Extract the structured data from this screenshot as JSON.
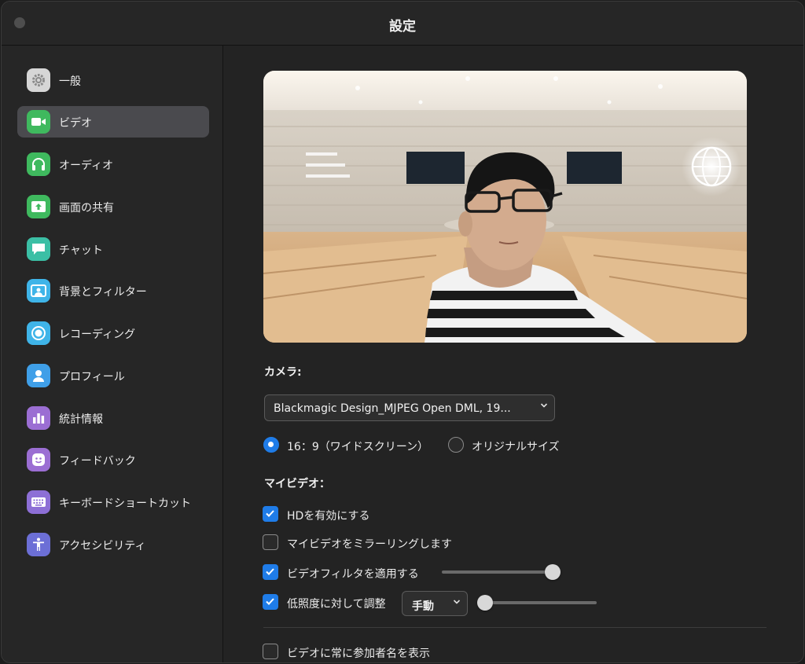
{
  "window": {
    "title": "設定"
  },
  "sidebar": {
    "items": [
      {
        "label": "一般",
        "icon": "gear-icon",
        "color": "#d6d6d6",
        "selected": false
      },
      {
        "label": "ビデオ",
        "icon": "video-camera-icon",
        "color": "#3fb95e",
        "selected": true
      },
      {
        "label": "オーディオ",
        "icon": "headphones-icon",
        "color": "#3fb95e",
        "selected": false
      },
      {
        "label": "画面の共有",
        "icon": "share-screen-icon",
        "color": "#3fb95e",
        "selected": false
      },
      {
        "label": "チャット",
        "icon": "chat-bubble-icon",
        "color": "#3bbfa5",
        "selected": false
      },
      {
        "label": "背景とフィルター",
        "icon": "background-portrait-icon",
        "color": "#3fb4e8",
        "selected": false
      },
      {
        "label": "レコーディング",
        "icon": "record-icon",
        "color": "#3fb4e8",
        "selected": false
      },
      {
        "label": "プロフィール",
        "icon": "person-icon",
        "color": "#3f9fe8",
        "selected": false
      },
      {
        "label": "統計情報",
        "icon": "bar-chart-icon",
        "color": "#9b6ed3",
        "selected": false
      },
      {
        "label": "フィードバック",
        "icon": "smiley-icon",
        "color": "#9b6ed3",
        "selected": false
      },
      {
        "label": "キーボードショートカット",
        "icon": "keyboard-icon",
        "color": "#8d6fd6",
        "selected": false
      },
      {
        "label": "アクセシビリティ",
        "icon": "accessibility-icon",
        "color": "#6c6fd6",
        "selected": false
      }
    ]
  },
  "video": {
    "camera_label": "カメラ:",
    "camera_value": "Blackmagic Design_MJPEG Open DML, 19...",
    "aspect_options": [
      {
        "label": "16：9（ワイドスクリーン）",
        "selected": true
      },
      {
        "label": "オリジナルサイズ",
        "selected": false
      }
    ],
    "my_video_label": "マイビデオ：",
    "options": [
      {
        "label": "HDを有効にする",
        "checked": true
      },
      {
        "label": "マイビデオをミラーリングします",
        "checked": false
      },
      {
        "label": "ビデオフィルタを適用する",
        "checked": true,
        "slider_level": 1.0
      },
      {
        "label": "低照度に対して調整",
        "checked": true,
        "mode": "手動",
        "slider_level": 0.0
      },
      {
        "label": "ビデオに常に参加者名を表示",
        "checked": false
      }
    ]
  },
  "colors": {
    "accent": "#1f7ce8",
    "selected_nav": "#4a4a4e"
  }
}
